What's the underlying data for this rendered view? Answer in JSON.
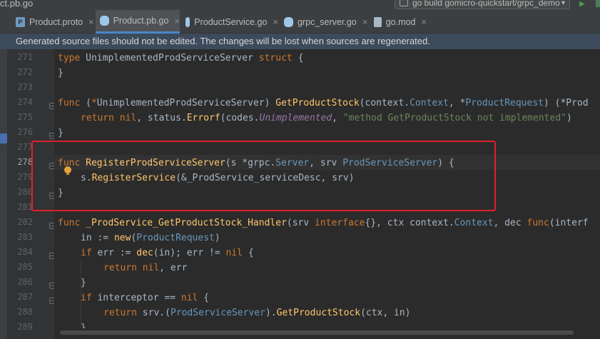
{
  "window": {
    "file_title": "ct.pb.go"
  },
  "run_config": {
    "label": "go build gomicro-quickstart/grpc_demo"
  },
  "tabs": [
    {
      "label": "Product.proto",
      "icon": "proto-file-icon",
      "active": false
    },
    {
      "label": "Product.pb.go",
      "icon": "go-file-icon",
      "active": true
    },
    {
      "label": "ProductService.go",
      "icon": "go-file-icon",
      "active": false
    },
    {
      "label": "grpc_server.go",
      "icon": "go-file-icon",
      "active": false
    },
    {
      "label": "go.mod",
      "icon": "mod-file-icon",
      "active": false
    }
  ],
  "banner": {
    "text": "Generated source files should not be edited. The changes will be lost when sources are regenerated."
  },
  "gutter": {
    "lines": [
      "271",
      "272",
      "273",
      "274",
      "275",
      "276",
      "277",
      "278",
      "279",
      "280",
      "281",
      "282",
      "283",
      "284",
      "285",
      "286",
      "287",
      "288",
      "289"
    ],
    "current_line": "278"
  },
  "code": {
    "l271": {
      "kw": "type",
      "name": "UnimplementedProdServiceServer",
      "kw2": "struct",
      "rest": " {"
    },
    "l272": "}",
    "l274": {
      "kw": "func",
      "p1": " (",
      "p2": "*",
      "recv": "UnimplementedProdServiceServer",
      "p3": ") ",
      "fn": "GetProductStock",
      "p4": "(context.",
      "ctx": "Context",
      "p5": ", *",
      "req": "ProductRequest",
      "p6": ") (*Prod"
    },
    "l275": {
      "kw": "return",
      "nil": "nil",
      "p1": ", status.",
      "fn": "Errorf",
      "p2": "(codes.",
      "it": "Unimplemented",
      "p3": ", ",
      "st": "\"method GetProductStock not implemented\"",
      "p4": ")"
    },
    "l276": "}",
    "l278": {
      "kw": "func",
      "fn": "RegisterProdServiceServer",
      "p1": "(s *grpc.",
      "srv": "Server",
      "p2": ", srv ",
      "iface": "ProdServiceServer",
      "p3": ") {"
    },
    "l279": {
      "p1": "s.",
      "fn": "RegisterService",
      "p2": "(&_ProdService_serviceDesc, srv)"
    },
    "l280": "}",
    "l282": {
      "kw": "func",
      "fn": "_ProdService_GetProductStock_Handler",
      "p1": "(srv ",
      "iface": "interface",
      "p2": "{}, ctx context.",
      "ctx": "Context",
      "p3": ", dec ",
      "kw2": "func",
      "p4": "(interf"
    },
    "l283": {
      "p1": "in := ",
      "fn": "new",
      "p2": "(",
      "ty": "ProductRequest",
      "p3": ")"
    },
    "l284": {
      "kw": "if",
      "p1": " err := ",
      "fn": "dec",
      "p2": "(in); err != ",
      "nil": "nil",
      "p3": " {"
    },
    "l285": {
      "kw": "return",
      "nil": "nil",
      "p1": ", err"
    },
    "l286": "}",
    "l287": {
      "kw": "if",
      "p1": " interceptor == ",
      "nil": "nil",
      "p2": " {"
    },
    "l288": {
      "kw": "return",
      "p1": " srv.(",
      "ty": "ProdServiceServer",
      "p2": ").",
      "fn": "GetProductStock",
      "p3": "(ctx, in)"
    },
    "l289": "}"
  },
  "colors": {
    "keyword": "#cc7832",
    "function": "#ffc66d",
    "type": "#6897bb",
    "string": "#6a8759",
    "constant": "#9876aa",
    "highlight_box": "#e0202a",
    "banner_bg": "#3d4a5c"
  }
}
